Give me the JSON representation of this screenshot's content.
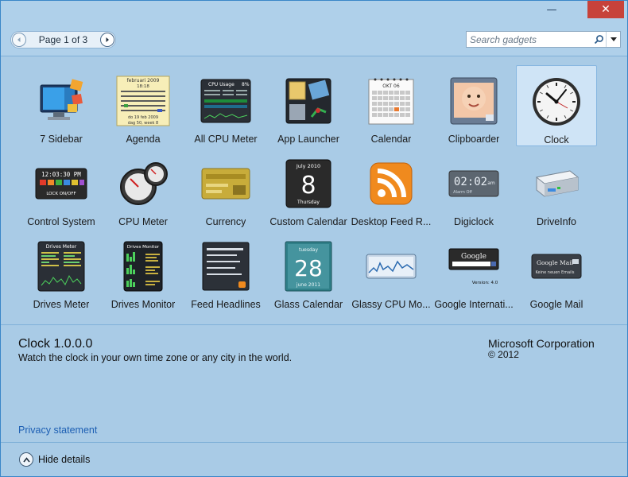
{
  "window": {
    "minimize_glyph": "—",
    "close_glyph": "✕"
  },
  "toolbar": {
    "page_label": "Page 1 of 3",
    "prev_icon": "left-arrow",
    "next_icon": "right-arrow",
    "search_placeholder": "Search gadgets",
    "search_icon": "search-icon",
    "dropdown_icon": "chevron-down-icon"
  },
  "gadgets": [
    {
      "label": "7 Sidebar",
      "icon": "monitor-sidebar-icon"
    },
    {
      "label": "Agenda",
      "icon": "calendar-agenda-icon"
    },
    {
      "label": "All CPU Meter",
      "icon": "cpu-meter-icon"
    },
    {
      "label": "App Launcher",
      "icon": "app-launcher-icon"
    },
    {
      "label": "Calendar",
      "icon": "calendar-icon"
    },
    {
      "label": "Clipboarder",
      "icon": "clipboard-photo-icon"
    },
    {
      "label": "Clock",
      "icon": "clock-icon",
      "selected": true
    },
    {
      "label": "Control System",
      "icon": "control-system-icon"
    },
    {
      "label": "CPU Meter",
      "icon": "cpu-gauge-icon"
    },
    {
      "label": "Currency",
      "icon": "currency-card-icon"
    },
    {
      "label": "Custom Calendar",
      "icon": "custom-calendar-icon"
    },
    {
      "label": "Desktop Feed R...",
      "icon": "rss-feed-icon"
    },
    {
      "label": "Digiclock",
      "icon": "digital-clock-icon"
    },
    {
      "label": "DriveInfo",
      "icon": "drive-icon"
    },
    {
      "label": "Drives Meter",
      "icon": "drives-meter-icon"
    },
    {
      "label": "Drives Monitor",
      "icon": "drives-monitor-icon"
    },
    {
      "label": "Feed Headlines",
      "icon": "feed-headlines-icon"
    },
    {
      "label": "Glass Calendar",
      "icon": "glass-calendar-icon"
    },
    {
      "label": "Glassy CPU Mo...",
      "icon": "glassy-cpu-icon"
    },
    {
      "label": "Google Internati...",
      "icon": "google-search-icon"
    },
    {
      "label": "Google Mail",
      "icon": "google-mail-icon"
    }
  ],
  "thumb_text": {
    "agenda_month": "februari 2009",
    "agenda_time": "18:18",
    "agenda_date": "do 19 feb 2009",
    "agenda_week": "dag 50, week 8",
    "cpu_title": "CPU Usage",
    "cpu_pct": "8%",
    "cal_month": "OKT 06",
    "control_time": "12:03:30 PM",
    "control_lock": "LOCK ON/OFF",
    "custom_cal_month": "July 2010",
    "custom_cal_day": "8",
    "custom_cal_weekday": "Thursday",
    "digi_time": "02:02",
    "digi_ampm": "am",
    "digi_sub": "Alarm Off",
    "drives_meter_title": "Drives Meter",
    "drives_monitor_title": "Drives Monitor",
    "glass_weekday": "tuesday",
    "glass_day": "28",
    "glass_month": "june 2011",
    "google_version": "Version: 4.0",
    "google_mail_label": "Google Mail",
    "google_mail_sub": "Keine neuen Emails"
  },
  "details": {
    "title": "Clock 1.0.0.0",
    "description": "Watch the clock in your own time zone or any city in the world.",
    "publisher": "Microsoft Corporation",
    "copyright": "© 2012",
    "privacy_link": "Privacy statement"
  },
  "footer": {
    "hide_label": "Hide details"
  },
  "colors": {
    "window_bg": "#a9cbe6",
    "selection_bg": "#cfe4f6",
    "link": "#1d5fb3",
    "close_red": "#c7423a"
  }
}
